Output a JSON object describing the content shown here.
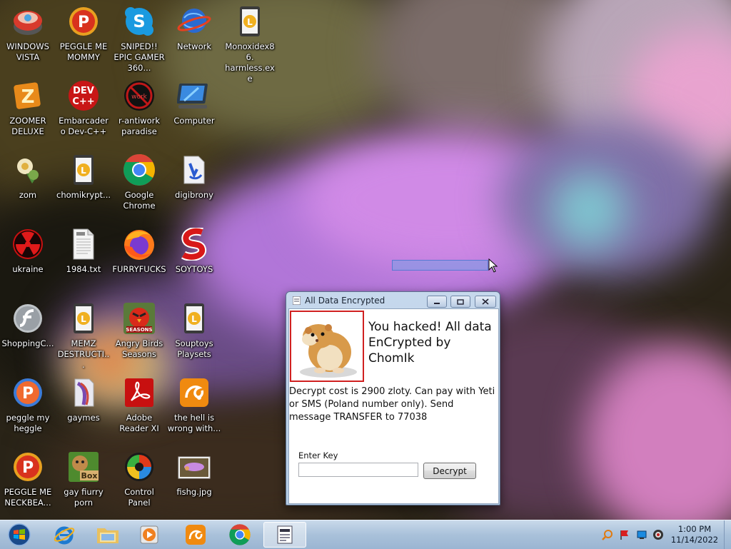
{
  "desktop": {
    "icons": [
      {
        "label": "WINDOWS VISTA",
        "icon": "vista-orb-icon"
      },
      {
        "label": "PEGGLE ME MOMMY",
        "icon": "peggle-icon"
      },
      {
        "label": "SNIPED!! EPIC GAMER 360...",
        "icon": "skype-icon"
      },
      {
        "label": "Network",
        "icon": "network-icon"
      },
      {
        "label": "Monoxidex86. harmless.exe",
        "icon": "generic-exe-icon"
      },
      {
        "label": "ZOOMER DELUXE",
        "icon": "zoomer-icon"
      },
      {
        "label": "Embarcadero Dev-C++",
        "icon": "devcpp-icon"
      },
      {
        "label": "r-antiwork paradise",
        "icon": "antiwork-icon"
      },
      {
        "label": "Computer",
        "icon": "computer-icon"
      },
      {
        "label": "zom",
        "icon": "zom-icon"
      },
      {
        "label": "chomikrypt...",
        "icon": "generic-exe-icon"
      },
      {
        "label": "Google Chrome",
        "icon": "chrome-icon"
      },
      {
        "label": "digibrony",
        "icon": "digibrony-icon"
      },
      {
        "label": "ukraine",
        "icon": "radiation-icon"
      },
      {
        "label": "1984.txt",
        "icon": "text-file-icon"
      },
      {
        "label": "FURRYFUCKS",
        "icon": "firefox-icon"
      },
      {
        "label": "SOYTOYS",
        "icon": "soytoys-icon"
      },
      {
        "label": "ShoppingC...",
        "icon": "flash-icon"
      },
      {
        "label": "MEMZ DESTRUCTI...",
        "icon": "generic-exe-icon"
      },
      {
        "label": "Angry Birds Seasons",
        "icon": "angry-birds-icon"
      },
      {
        "label": "Souptoys Playsets",
        "icon": "generic-exe-icon"
      },
      {
        "label": "peggle my heggle",
        "icon": "peggle-icon"
      },
      {
        "label": "gaymes",
        "icon": "gaymes-icon"
      },
      {
        "label": "Adobe Reader XI",
        "icon": "adobe-reader-icon"
      },
      {
        "label": "the hell is wrong with...",
        "icon": "uc-browser-icon"
      },
      {
        "label": "PEGGLE ME NECKBEA...",
        "icon": "peggle-icon"
      },
      {
        "label": "gay fiurry porn",
        "icon": "box-icon"
      },
      {
        "label": "Control Panel",
        "icon": "control-panel-icon"
      },
      {
        "label": "fishg.jpg",
        "icon": "image-file-icon"
      }
    ]
  },
  "dialog": {
    "title": "All Data Encrypted",
    "headline": "You hacked! All data EnCrypted by ChomIk",
    "message": "Decrypt cost is 2900 zloty. Can pay with Yeti or SMS (Poland number only). Send message TRANSFER to 77038",
    "enter_key_label": "Enter Key",
    "key_value": "",
    "decrypt_label": "Decrypt",
    "image_icon": "hamster-image"
  },
  "taskbar": {
    "pinned": [
      {
        "icon": "start-orb-icon"
      },
      {
        "icon": "internet-explorer-icon"
      },
      {
        "icon": "file-explorer-icon"
      },
      {
        "icon": "media-player-icon"
      },
      {
        "icon": "uc-browser-icon"
      },
      {
        "icon": "chrome-icon"
      },
      {
        "icon": "ransomware-window-icon"
      }
    ],
    "tray": [
      "search-tray-icon",
      "flag-tray-icon",
      "network-tray-icon",
      "volume-tray-icon"
    ],
    "clock_time": "1:00 PM",
    "clock_date": "11/14/2022"
  },
  "colors": {
    "taskbar": "#a9c1da",
    "dialog_frame": "#b4cbe4",
    "image_border": "#d02020"
  }
}
